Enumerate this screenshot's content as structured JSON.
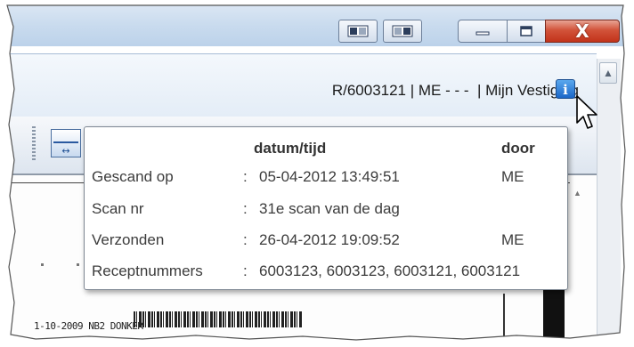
{
  "window": {
    "close_label": "X"
  },
  "header": {
    "info_text": "R/6003121 | ME - - -  | Mijn Vestiging",
    "info_icon_glyph": "i"
  },
  "tooltip": {
    "columns": {
      "datetime": "datum/tijd",
      "by": "door"
    },
    "rows": [
      {
        "label": "Gescand op",
        "sep": ":",
        "value": "05-04-2012 13:49:51",
        "by": "ME"
      },
      {
        "label": "Scan nr",
        "sep": ":",
        "value": "31e scan van de dag",
        "by": ""
      },
      {
        "label": "Verzonden",
        "sep": ":",
        "value": "26-04-2012 19:09:52",
        "by": "ME"
      },
      {
        "label": "Receptnummers",
        "sep": ":",
        "value": "6003123, 6003123, 6003121, 6003121",
        "by": ""
      }
    ]
  },
  "document": {
    "footer_text": "1-10-2009 NB2 DONKER"
  },
  "icons": {
    "info": "info-icon",
    "fit_width": "fit-width-icon",
    "cursor": "mouse-pointer-icon"
  }
}
